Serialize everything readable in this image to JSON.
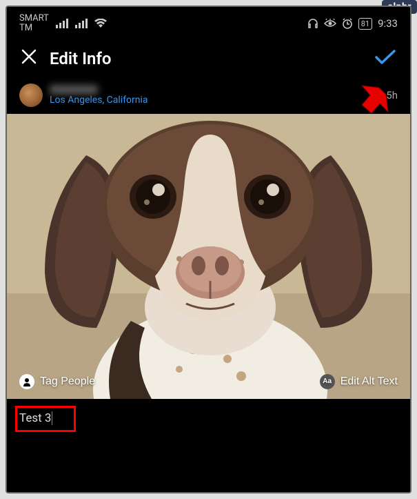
{
  "status_bar": {
    "carrier_line1": "SMART",
    "carrier_line2": "TM",
    "battery": "81",
    "time": "9:33"
  },
  "header": {
    "title": "Edit Info"
  },
  "post": {
    "location": "Los Angeles, California",
    "timestamp": "5h",
    "tag_people_label": "Tag People",
    "alt_text_label": "Edit Alt Text",
    "alt_icon_text": "Aa"
  },
  "caption": {
    "value": "Test 3"
  },
  "watermark": "alphr"
}
